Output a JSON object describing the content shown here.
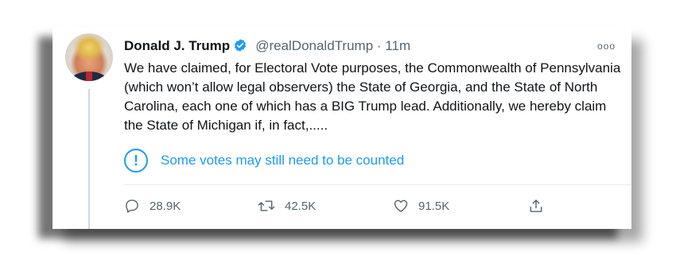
{
  "tweet": {
    "author_name": "Donald J. Trump",
    "handle": "@realDonaldTrump",
    "separator": "·",
    "time": "11m",
    "more_label": "ooo",
    "text": "We have claimed, for Electoral Vote purposes, the Commonwealth of Pennsylvania (which won’t allow legal observers) the State of Georgia, and the State of North Carolina, each one of which has a BIG Trump lead. Additionally, we hereby claim the State of Michigan if, in fact,.....",
    "notice": {
      "icon": "exclamation-circle-icon",
      "symbol": "!",
      "text": "Some votes may still need to be counted"
    },
    "metrics": {
      "replies": "28.9K",
      "retweets": "42.5K",
      "likes": "91.5K"
    }
  },
  "colors": {
    "accent": "#1d9bf0",
    "text": "#0f1419",
    "secondary": "#536471"
  }
}
